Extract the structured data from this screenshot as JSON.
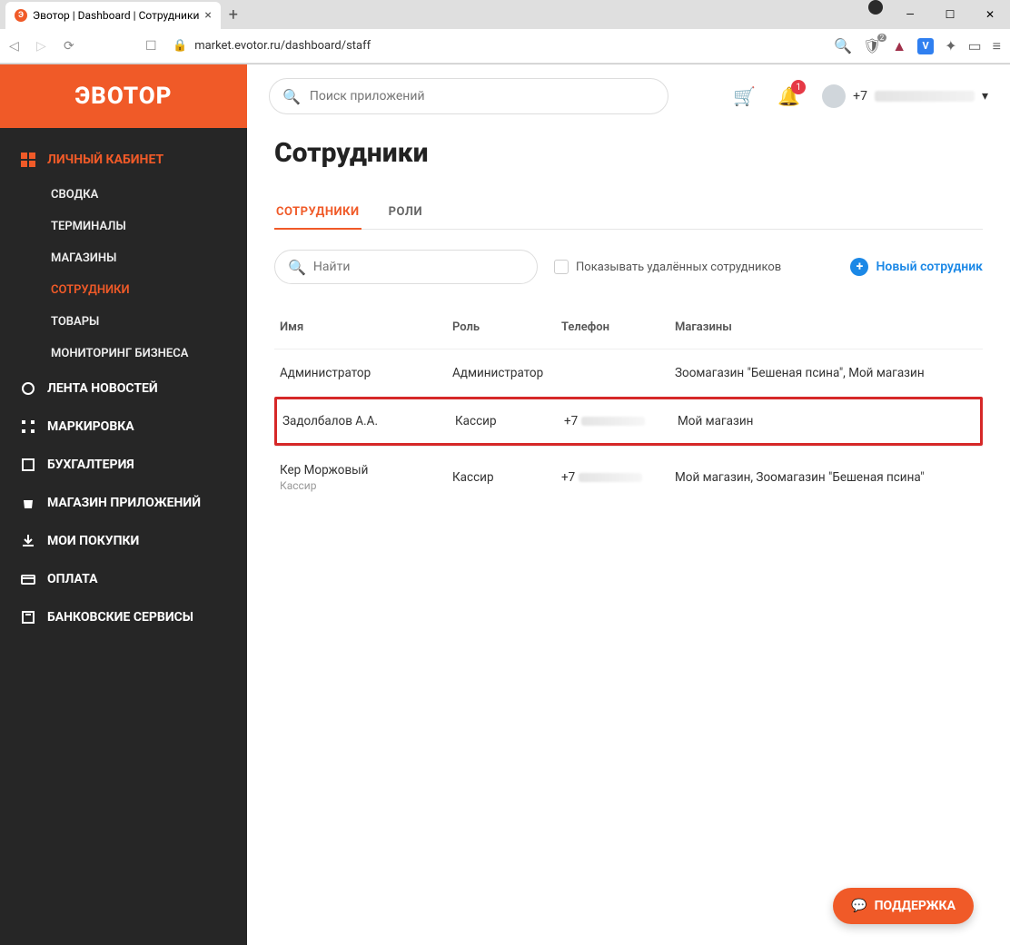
{
  "browser": {
    "tab_title": "Эвотор | Dashboard | Сотрудники",
    "url": "market.evotor.ru/dashboard/staff"
  },
  "brand": "ЭВОТОР",
  "topbar": {
    "search_placeholder": "Поиск приложений",
    "notification_count": "1",
    "user_phone_prefix": "+7"
  },
  "sidebar": {
    "section_dashboard": "ЛИЧНЫЙ КАБИНЕТ",
    "items": [
      {
        "label": "СВОДКА"
      },
      {
        "label": "ТЕРМИНАЛЫ"
      },
      {
        "label": "МАГАЗИНЫ"
      },
      {
        "label": "СОТРУДНИКИ"
      },
      {
        "label": "ТОВАРЫ"
      },
      {
        "label": "МОНИТОРИНГ БИЗНЕСА"
      }
    ],
    "news": "ЛЕНТА НОВОСТЕЙ",
    "marking": "МАРКИРОВКА",
    "accounting": "БУХГАЛТЕРИЯ",
    "appstore": "МАГАЗИН ПРИЛОЖЕНИЙ",
    "purchases": "МОИ ПОКУПКИ",
    "payment": "ОПЛАТА",
    "banking": "БАНКОВСКИЕ СЕРВИСЫ"
  },
  "page": {
    "title": "Сотрудники",
    "tabs": {
      "staff": "СОТРУДНИКИ",
      "roles": "РОЛИ"
    },
    "find_placeholder": "Найти",
    "show_deleted": "Показывать удалённых сотрудников",
    "new_employee": "Новый сотрудник",
    "columns": {
      "name": "Имя",
      "role": "Роль",
      "phone": "Телефон",
      "stores": "Магазины"
    },
    "rows": [
      {
        "name": "Администратор",
        "sub": "",
        "role": "Администратор",
        "phone_prefix": "",
        "stores": "Зоомагазин \"Бешеная псина\", Мой магазин"
      },
      {
        "name": "Задолбалов А.А.",
        "sub": "",
        "role": "Кассир",
        "phone_prefix": "+7",
        "stores": "Мой магазин"
      },
      {
        "name": "Кер Моржовый",
        "sub": "Кассир",
        "role": "Кассир",
        "phone_prefix": "+7",
        "stores": "Мой магазин, Зоомагазин \"Бешеная псина\""
      }
    ]
  },
  "support_label": "ПОДДЕРЖКА"
}
